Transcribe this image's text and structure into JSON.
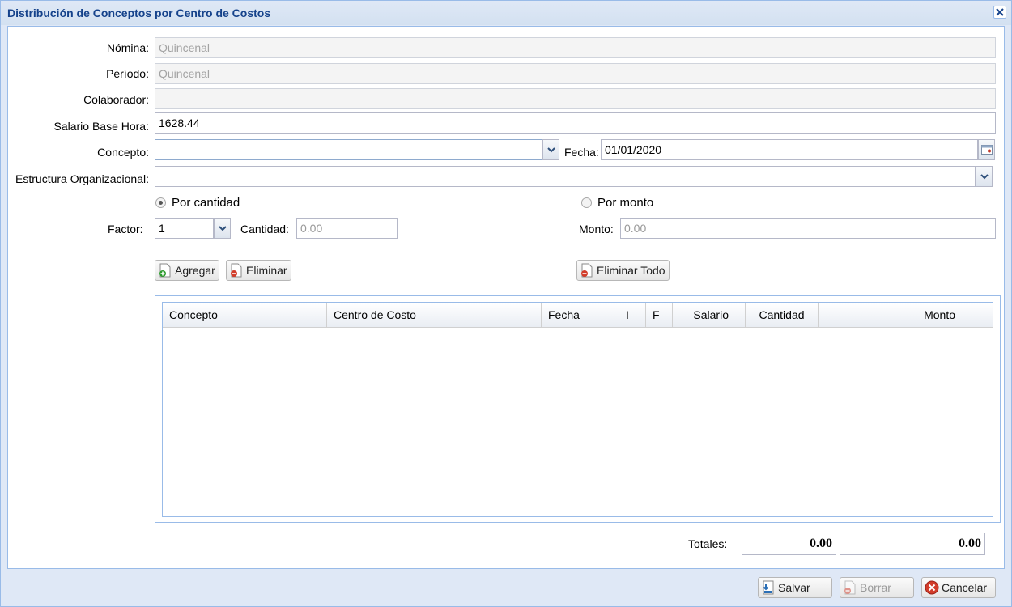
{
  "window": {
    "title": "Distribución de Conceptos por Centro de Costos"
  },
  "form": {
    "nomina": {
      "label": "Nómina:",
      "value": "Quincenal"
    },
    "periodo": {
      "label": "Período:",
      "value": "Quincenal"
    },
    "colaborador": {
      "label": "Colaborador:",
      "value": ""
    },
    "salario": {
      "label": "Salario Base Hora:",
      "value": "1628.44"
    },
    "concepto": {
      "label": "Concepto:",
      "value": ""
    },
    "fecha": {
      "label": "Fecha:",
      "value": "01/01/2020"
    },
    "estructura": {
      "label": "Estructura Organizacional:",
      "value": ""
    },
    "por_cantidad": {
      "label": "Por cantidad",
      "checked": true
    },
    "por_monto": {
      "label": "Por monto",
      "checked": false
    },
    "factor": {
      "label": "Factor:",
      "value": "1"
    },
    "cantidad": {
      "label": "Cantidad:",
      "placeholder": "0.00"
    },
    "monto": {
      "label": "Monto:",
      "placeholder": "0.00"
    }
  },
  "actions": {
    "agregar": "Agregar",
    "eliminar": "Eliminar",
    "eliminar_todo": "Eliminar Todo"
  },
  "grid": {
    "columns": [
      "Concepto",
      "Centro de Costo",
      "Fecha",
      "I",
      "F",
      "Salario",
      "Cantidad",
      "Monto"
    ],
    "rows": []
  },
  "totals": {
    "label": "Totales:",
    "cantidad": "0.00",
    "monto": "0.00"
  },
  "footer": {
    "salvar": "Salvar",
    "borrar": "Borrar",
    "cancelar": "Cancelar"
  }
}
